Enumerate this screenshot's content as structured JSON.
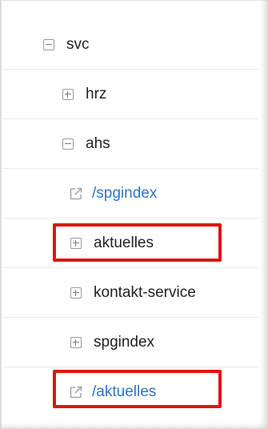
{
  "tree": {
    "items": [
      {
        "label": "svc",
        "icon": "collapse-icon",
        "kind": "folder"
      },
      {
        "label": "hrz",
        "icon": "expand-icon",
        "kind": "folder"
      },
      {
        "label": "ahs",
        "icon": "collapse-icon",
        "kind": "folder"
      },
      {
        "label": "/spgindex",
        "icon": "external-link-icon",
        "kind": "link"
      },
      {
        "label": "aktuelles",
        "icon": "expand-icon",
        "kind": "folder",
        "highlighted": true
      },
      {
        "label": "kontakt-service",
        "icon": "expand-icon",
        "kind": "folder"
      },
      {
        "label": "spgindex",
        "icon": "expand-icon",
        "kind": "folder"
      },
      {
        "label": "/aktuelles",
        "icon": "external-link-icon",
        "kind": "link",
        "highlighted": true
      }
    ]
  },
  "colors": {
    "link": "#2e74c9",
    "text": "#222222",
    "highlight": "#e01414",
    "icon": "#9a9a9a"
  }
}
